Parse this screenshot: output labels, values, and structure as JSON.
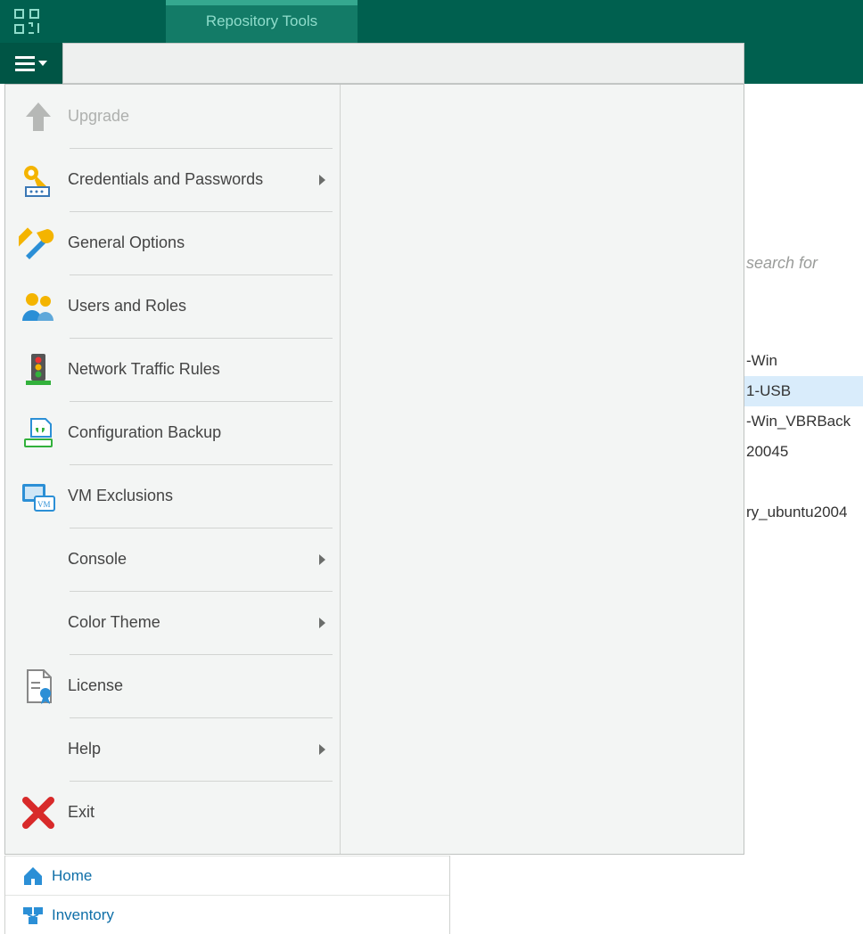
{
  "ribbon": {
    "tab_label": "Repository Tools"
  },
  "menu": {
    "items": [
      {
        "label": "Upgrade",
        "has_submenu": false,
        "disabled": true
      },
      {
        "label": "Credentials and Passwords",
        "has_submenu": true,
        "disabled": false
      },
      {
        "label": "General Options",
        "has_submenu": false,
        "disabled": false
      },
      {
        "label": "Users and Roles",
        "has_submenu": false,
        "disabled": false
      },
      {
        "label": "Network Traffic Rules",
        "has_submenu": false,
        "disabled": false
      },
      {
        "label": "Configuration Backup",
        "has_submenu": false,
        "disabled": false
      },
      {
        "label": "VM Exclusions",
        "has_submenu": false,
        "disabled": false
      },
      {
        "label": "Console",
        "has_submenu": true,
        "disabled": false
      },
      {
        "label": "Color Theme",
        "has_submenu": true,
        "disabled": false
      },
      {
        "label": "License",
        "has_submenu": false,
        "disabled": false
      },
      {
        "label": "Help",
        "has_submenu": true,
        "disabled": false
      },
      {
        "label": "Exit",
        "has_submenu": false,
        "disabled": false
      }
    ]
  },
  "nav": {
    "home": "Home",
    "inventory": "Inventory"
  },
  "search": {
    "placeholder": "search for"
  },
  "list_peek": [
    {
      "text": "-Win",
      "selected": false
    },
    {
      "text": "1-USB",
      "selected": true
    },
    {
      "text": "-Win_VBRBack",
      "selected": false
    },
    {
      "text": "20045",
      "selected": false
    },
    {
      "text": "",
      "spacer": true
    },
    {
      "text": "ry_ubuntu2004",
      "selected": false
    }
  ]
}
